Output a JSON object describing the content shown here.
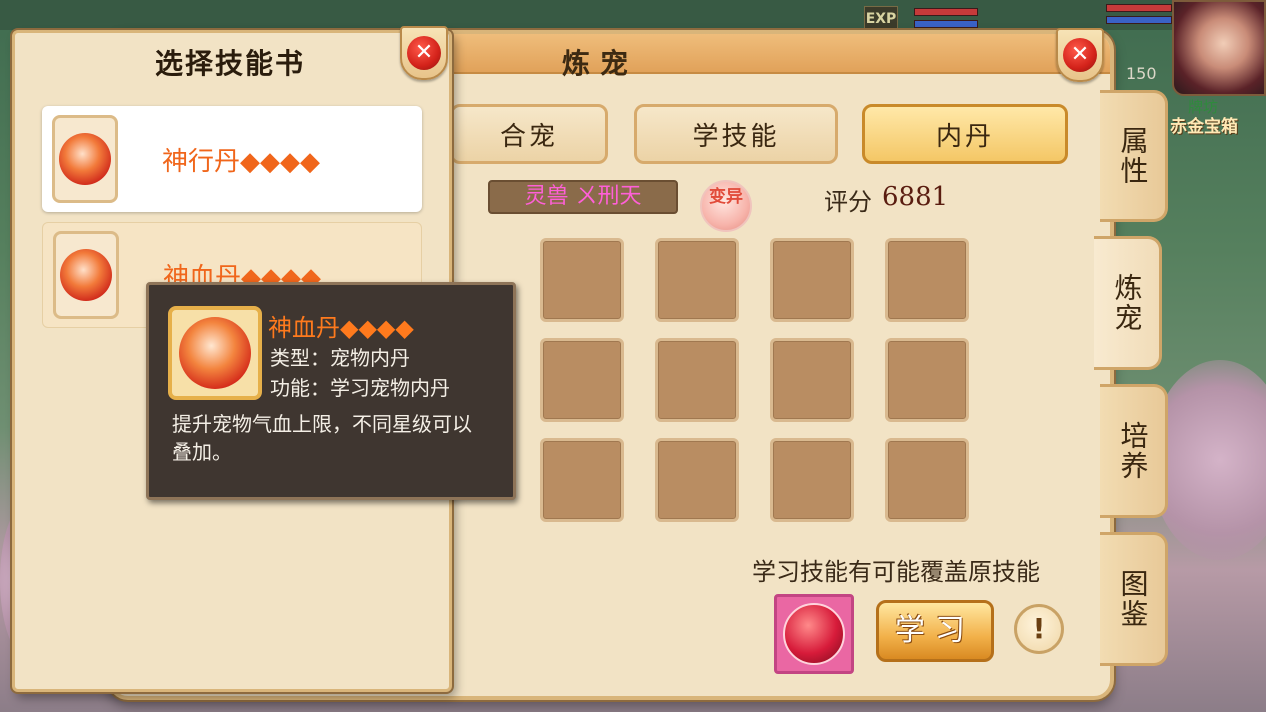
{
  "hud": {
    "exp_label": "EXP",
    "level": "150",
    "player_name": "牌坊",
    "chest_label": "赤金宝箱"
  },
  "main": {
    "title": "炼宠",
    "tabs": [
      {
        "label": "合宠",
        "active": false
      },
      {
        "label": "学技能",
        "active": false
      },
      {
        "label": "内丹",
        "active": true
      }
    ],
    "pet_name": "灵兽 ㄨ刑天",
    "mutate_badge": "变异",
    "score_label": "评分",
    "score_value": "6881",
    "slot_rows": 3,
    "slot_cols": 4,
    "hint": "学习技能有可能覆盖原技能",
    "learn_button": "学习",
    "info_button": "!"
  },
  "side_tabs": [
    {
      "label": "属性",
      "active": false
    },
    {
      "label": "炼宠",
      "active": true
    },
    {
      "label": "培养",
      "active": false
    },
    {
      "label": "图鉴",
      "active": false
    }
  ],
  "left_panel": {
    "title": "选择技能书",
    "items": [
      {
        "name": "神行丹◆◆◆◆",
        "selected": true
      },
      {
        "name": "神血丹◆◆◆◆",
        "selected": false
      }
    ]
  },
  "tooltip": {
    "name": "神血丹◆◆◆◆",
    "type_line": "类型：宠物内丹",
    "function_line": "功能：学习宠物内丹",
    "description_1": "提升宠物气血上限，不同星级可以",
    "description_2": "叠加。"
  },
  "colors": {
    "accent_orange": "#f0661b",
    "pet_name_pink": "#ff5fd8",
    "panel_bg": "#f2e3c5"
  }
}
